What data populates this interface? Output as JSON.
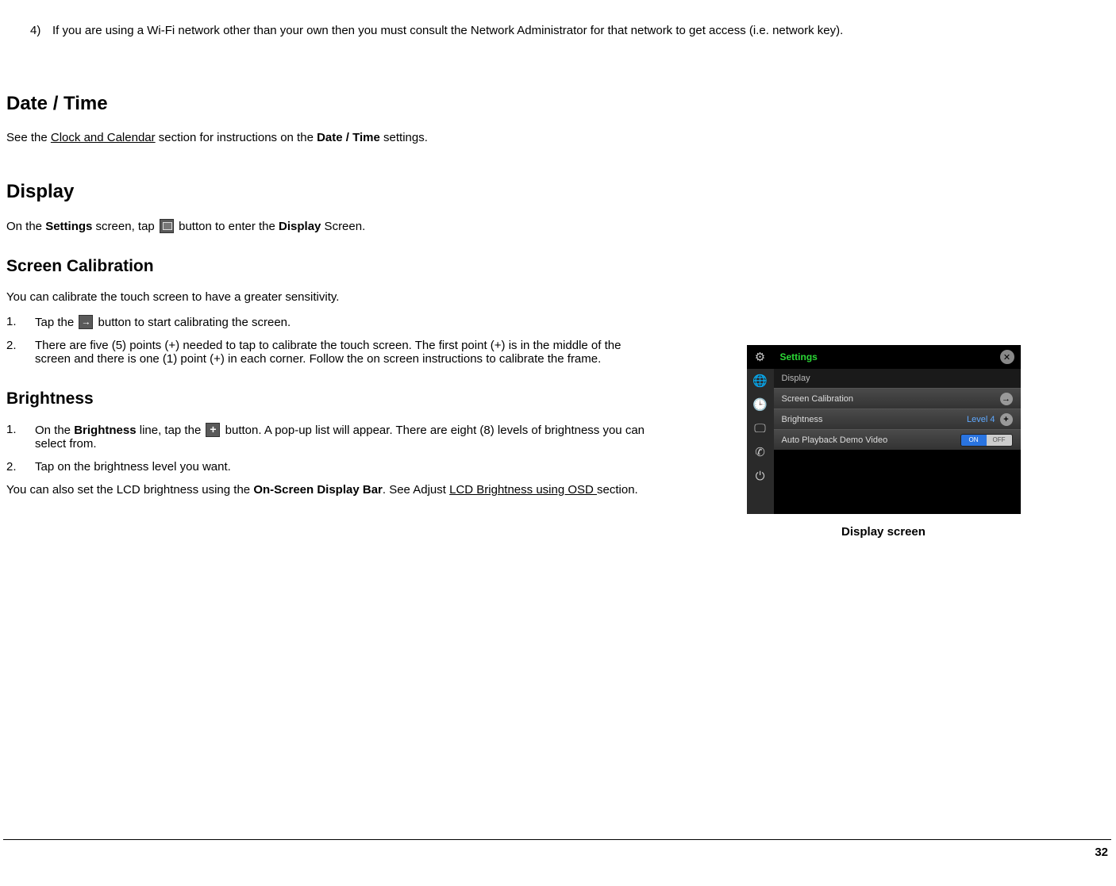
{
  "top_item": {
    "marker": "4)",
    "text": "If you are using a Wi-Fi network other than your own then you must consult the Network Administrator for that network to get access (i.e. network key)."
  },
  "date_time": {
    "heading": "Date / Time",
    "line_prefix": "See the ",
    "line_link": "Clock and Calendar",
    "line_mid": " section for instructions on the ",
    "line_bold": "Date / Time",
    "line_suffix": " settings."
  },
  "display": {
    "heading": "Display",
    "prefix": "On the ",
    "b1": "Settings",
    "mid1": " screen, tap ",
    "mid2": " button to enter the ",
    "b2": "Display",
    "suffix": " Screen."
  },
  "screen_cal": {
    "heading": "Screen Calibration",
    "intro": "You can calibrate the touch screen to have a greater sensitivity.",
    "items": [
      {
        "marker": "1.",
        "before": "Tap the ",
        "after": " button to start calibrating the screen."
      },
      {
        "marker": "2.",
        "text": "There are five (5) points (+) needed to tap to calibrate the touch screen.  The first point (+) is in the middle of the screen and there is one (1) point (+) in each corner.  Follow the on screen instructions to calibrate the frame."
      }
    ]
  },
  "brightness": {
    "heading": "Brightness",
    "items": [
      {
        "marker": "1.",
        "before": "On the ",
        "bold": "Brightness",
        "mid": " line, tap the ",
        "after": " button.  A pop-up list will appear.  There are eight (8) levels of brightness you can select from."
      },
      {
        "marker": "2.",
        "text": "Tap on the brightness level you want."
      }
    ],
    "osd_before": "You can also set the LCD brightness using the ",
    "osd_bold": "On-Screen Display Bar",
    "osd_mid": ".  See Adjust ",
    "osd_link": "LCD Brightness using OSD ",
    "osd_after": "section."
  },
  "device": {
    "title": "Settings",
    "subheader": "Display",
    "rows": {
      "calibration": "Screen Calibration",
      "brightness_label": "Brightness",
      "brightness_level": "Level 4",
      "auto_play": "Auto Playback Demo Video",
      "toggle_on": "ON",
      "toggle_off": "OFF"
    },
    "caption": "Display screen"
  },
  "page_number": "32"
}
